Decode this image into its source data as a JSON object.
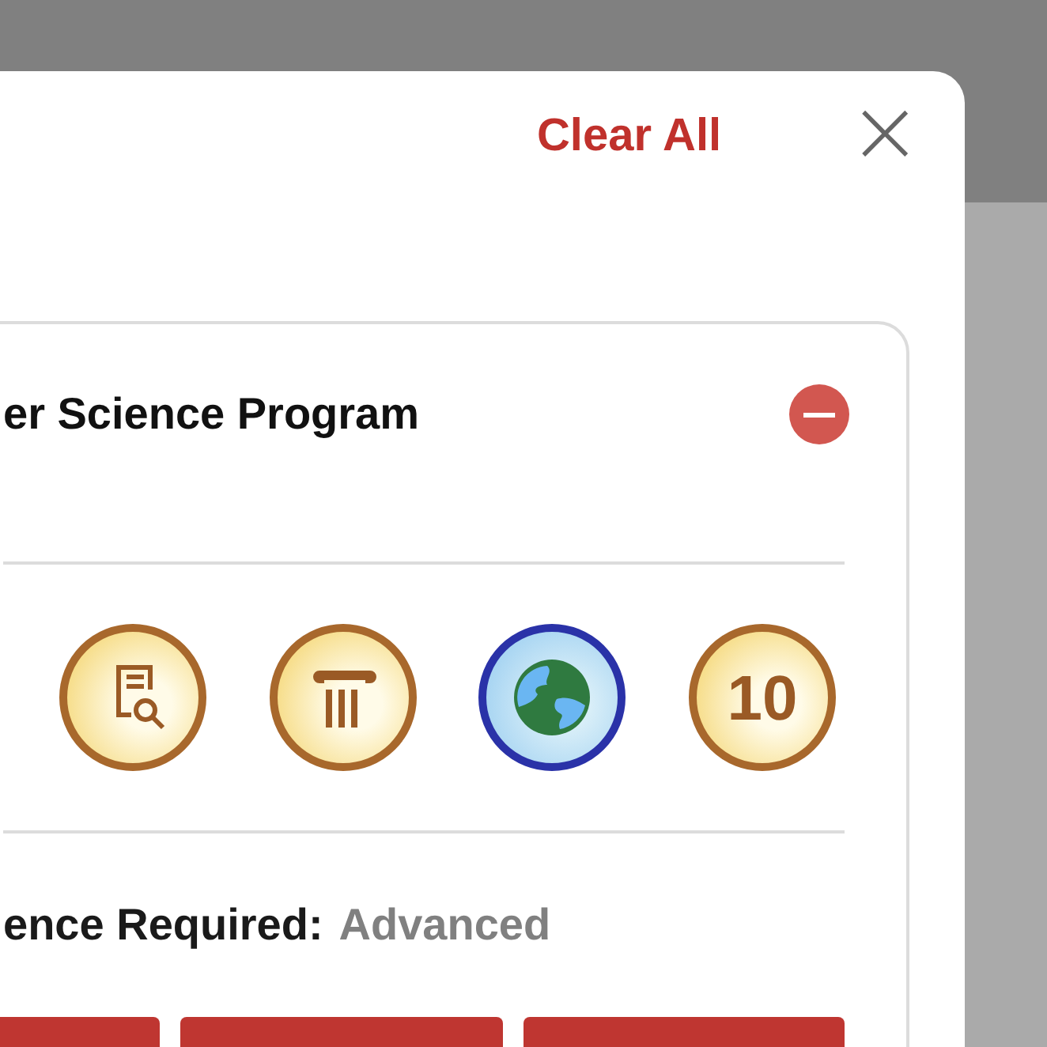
{
  "header": {
    "clear_label": "Clear All",
    "close_label": "×"
  },
  "program": {
    "title": "er Science Program",
    "badges": [
      {
        "kind": "document",
        "color": "#a8682c"
      },
      {
        "kind": "column",
        "color": "#a8682c"
      },
      {
        "kind": "globe",
        "color": "#2a32a8"
      },
      {
        "kind": "number",
        "color": "#a8682c",
        "text": "10"
      }
    ],
    "requirement": {
      "label": "ence Required:",
      "value": "Advanced"
    },
    "bars": [
      {
        "color": "#bf3631"
      },
      {
        "color": "#bf3631"
      },
      {
        "color": "#bf3631"
      }
    ]
  }
}
